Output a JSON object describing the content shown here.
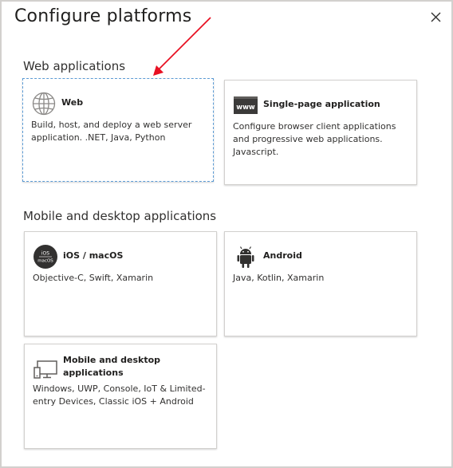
{
  "dialog": {
    "title": "Configure platforms",
    "close_label": "✕"
  },
  "sections": {
    "web": {
      "title": "Web applications",
      "cards": [
        {
          "title": "Web",
          "description": "Build, host, and deploy a web server application. .NET, Java, Python",
          "icon": "globe-icon"
        },
        {
          "title": "Single-page application",
          "description": "Configure browser client applications and progressive web applications. Javascript.",
          "icon": "www-icon"
        }
      ]
    },
    "mobile": {
      "title": "Mobile and desktop applications",
      "cards": [
        {
          "title": "iOS / macOS",
          "description": "Objective-C, Swift, Xamarin",
          "icon": "ios-macos-icon",
          "icon_text_top": "iOS",
          "icon_text_bottom": "macOS"
        },
        {
          "title": "Android",
          "description": "Java, Kotlin, Xamarin",
          "icon": "android-icon"
        },
        {
          "title": "Mobile and desktop applications",
          "description": "Windows, UWP, Console, IoT & Limited-entry Devices, Classic iOS + Android",
          "icon": "desktop-icon"
        }
      ]
    }
  },
  "colors": {
    "annotation_arrow": "#e81123",
    "selected_border": "#5b9bd5"
  }
}
